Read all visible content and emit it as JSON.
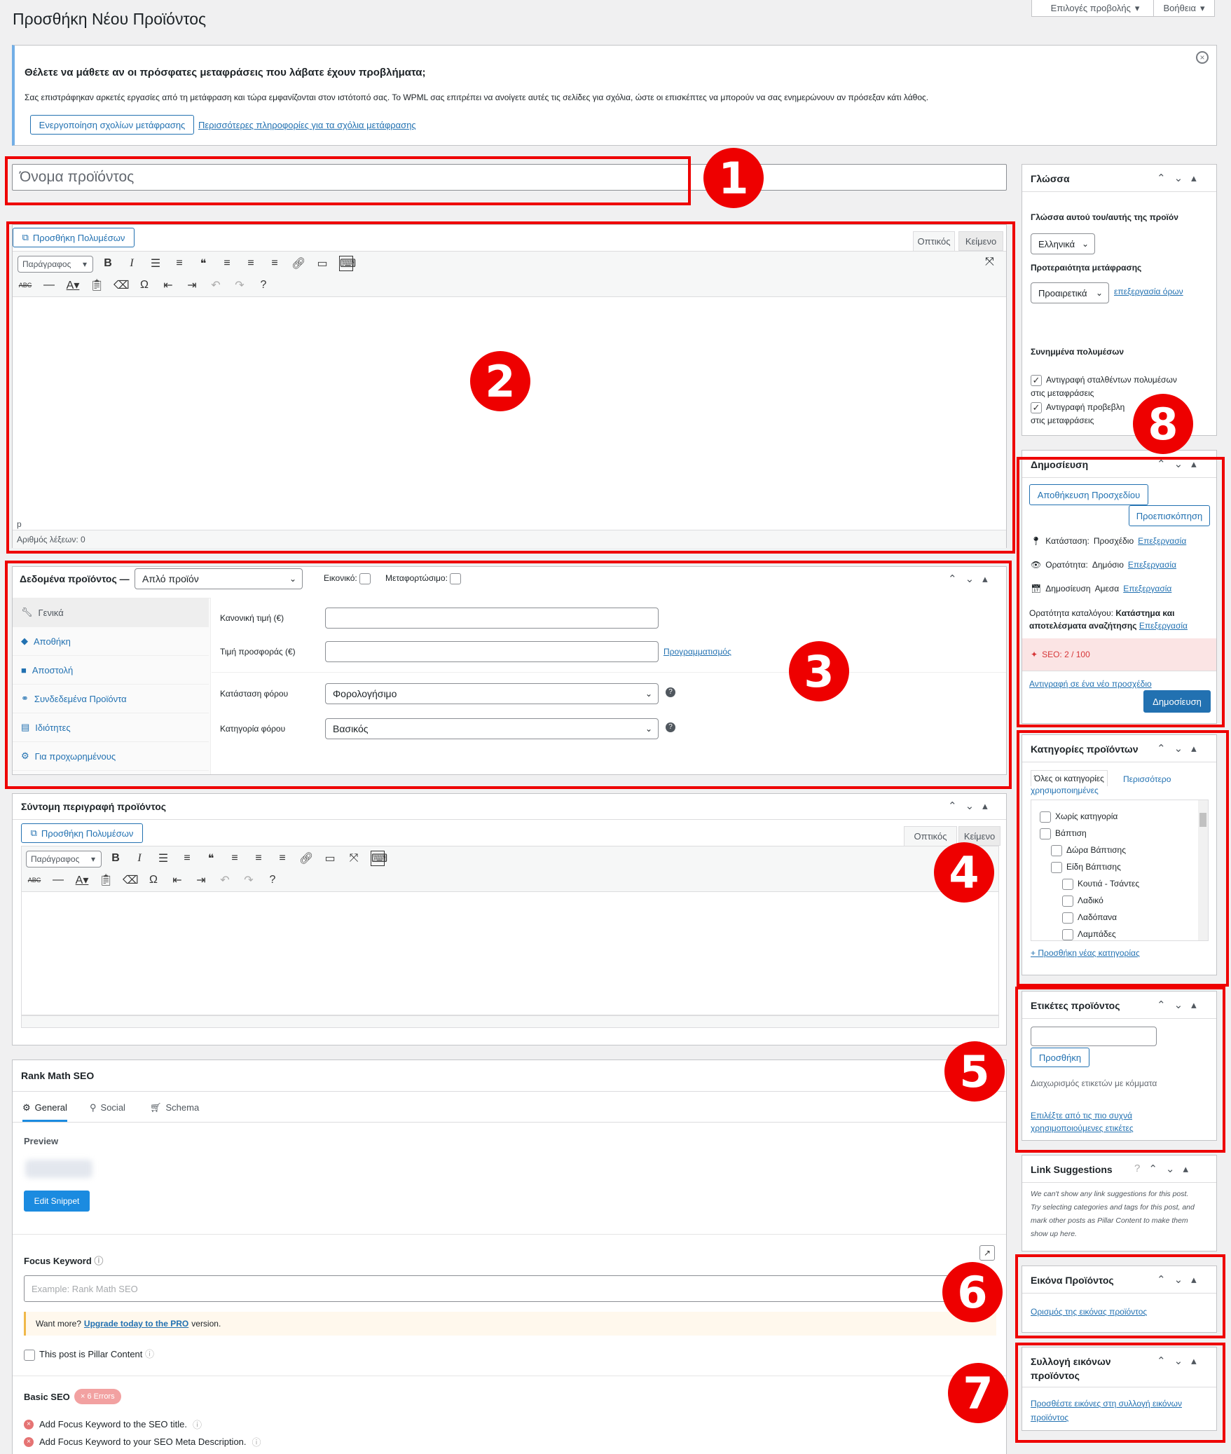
{
  "page": {
    "title": "Προσθήκη Νέου Προϊόντος"
  },
  "topbar": {
    "screen_options": "Επιλογές προβολής",
    "help": "Βοήθεια"
  },
  "notice": {
    "title": "Θέλετε να μάθετε αν οι πρόσφατες μεταφράσεις που λάβατε έχουν προβλήματα;",
    "body": "Σας επιστράφηκαν αρκετές εργασίες από τη μετάφραση και τώρα εμφανίζονται στον ιστότοπό σας. Το WPML σας επιτρέπει να ανοίγετε αυτές τις σελίδες για σχόλια, ώστε οι επισκέπτες να μπορούν να σας ενημερώνουν αν πρόσεξαν κάτι λάθος.",
    "enable_button": "Ενεργοποίηση σχολίων μετάφρασης",
    "more_link": "Περισσότερες πληροφορίες για τα σχόλια μετάφρασης"
  },
  "title_input": {
    "placeholder": "Όνομα προϊόντος"
  },
  "editor": {
    "add_media": "Προσθήκη Πολυμέσων",
    "tab_visual": "Οπτικός",
    "tab_text": "Κείμενο",
    "format": "Παράγραφος",
    "path": "p",
    "word_count": "Αριθμός λέξεων: 0"
  },
  "product_data": {
    "title": "Δεδομένα προϊόντος —",
    "type": "Απλό προϊόν",
    "virtual": "Εικονικό:",
    "downloadable": "Μεταφορτώσιμο:",
    "tabs": [
      "Γενικά",
      "Αποθήκη",
      "Αποστολή",
      "Συνδεδεμένα Προϊόντα",
      "Ιδιότητες",
      "Για προχωρημένους"
    ],
    "regular_price_label": "Κανονική τιμή (€)",
    "sale_price_label": "Τιμή προσφοράς (€)",
    "schedule_link": "Προγραμματισμός",
    "tax_status_label": "Κατάσταση φόρου",
    "tax_status_value": "Φορολογήσιμο",
    "tax_class_label": "Κατηγορία φόρου",
    "tax_class_value": "Βασικός"
  },
  "short_desc": {
    "title": "Σύντομη περιγραφή προϊόντος",
    "add_media": "Προσθήκη Πολυμέσων",
    "tab_visual": "Οπτικός",
    "tab_text": "Κείμενο",
    "format": "Παράγραφος"
  },
  "rankmath": {
    "title": "Rank Math SEO",
    "tabs": [
      "General",
      "Social",
      "Schema"
    ],
    "preview": "Preview",
    "edit_snippet": "Edit Snippet",
    "focus_keyword": "Focus Keyword",
    "focus_placeholder": "Example: Rank Math SEO",
    "want_more": "Want more?",
    "upgrade_link": "Upgrade today to the PRO",
    "version": "version.",
    "pillar": "This post is Pillar Content",
    "basic_seo": "Basic SEO",
    "errors_badge": "× 6 Errors",
    "checks": [
      "Add Focus Keyword to the SEO title.",
      "Add Focus Keyword to your SEO Meta Description."
    ]
  },
  "language_box": {
    "title": "Γλώσσα",
    "lang_label": "Γλώσσα αυτού του/αυτής της προϊόν",
    "lang_value": "Ελληνικά",
    "priority_label": "Προτεραιότητα μετάφρασης",
    "priority_value": "Προαιρετικά",
    "edit_terms": "επεξεργασία όρων",
    "media_label": "Συνημμένα πολυμέσων",
    "copy1a": "Αντιγραφή σταλθέντων πολυμέσων",
    "copy1b": "στις μεταφράσεις",
    "copy2a": "Αντιγραφή προβεβλη",
    "copy2b": "στις μεταφράσεις"
  },
  "publish": {
    "title": "Δημοσίευση",
    "save_draft": "Αποθήκευση Προσχεδίου",
    "preview": "Προεπισκόπηση",
    "status_label": "Κατάσταση:",
    "status_value": "Προσχέδιο",
    "visibility_label": "Ορατότητα:",
    "visibility_value": "Δημόσιο",
    "publish_label": "Δημοσίευση",
    "publish_value": "Αμεσα",
    "edit": "Επεξεργασία",
    "catalog_label": "Ορατότητα καταλόγου:",
    "catalog_value_a": "Κατάστημα και",
    "catalog_value_b": "αποτελέσματα αναζήτησης",
    "seo": "SEO: 2 / 100",
    "copy_draft": "Αντιγραφή σε ένα νέο προσχέδιο",
    "publish_button": "Δημοσίευση"
  },
  "categories": {
    "title": "Κατηγορίες προϊόντων",
    "tab_all": "Όλες οι κατηγορίες",
    "tab_popular_a": "Περισσότερο",
    "tab_popular_b": "χρησιμοποιημένες",
    "items": [
      "Χωρίς κατηγορία",
      "Βάπτιση",
      "Δώρα Βάπτισης",
      "Είδη Βάπτισης",
      "Κουτιά - Τσάντες",
      "Λαδικό",
      "Λαδόπανα",
      "Λαμπάδες"
    ],
    "add_new": "+ Προσθήκη νέας κατηγορίας"
  },
  "tags": {
    "title": "Ετικέτες προϊόντος",
    "add_button": "Προσθήκη",
    "hint": "Διαχωρισμός ετικετών με κόμματα",
    "choose_a": "Επιλέξτε από τις πιο συχνά",
    "choose_b": "χρησιμοποιούμενες ετικέτες"
  },
  "link_suggestions": {
    "title": "Link Suggestions",
    "lines": [
      "We can't show any link suggestions for this post.",
      "Try selecting categories and tags for this post, and",
      "mark other posts as Pillar Content to make them",
      "show up here."
    ]
  },
  "product_image": {
    "title": "Εικόνα Προϊόντος",
    "set_link": "Ορισμός της εικόνας προϊόντος"
  },
  "gallery": {
    "title_a": "Συλλογή εικόνων",
    "title_b": "προϊόντος",
    "link_a": "Προσθέστε εικόνες στη συλλογή εικόνων",
    "link_b": "προϊόντος"
  },
  "annotations": [
    "1",
    "2",
    "3",
    "4",
    "5",
    "6",
    "7",
    "8"
  ],
  "colors": {
    "annotation_red": "#ee0000",
    "wp_blue": "#2271b1",
    "rankmath_blue": "#1b8be0",
    "error_red": "#dd3333"
  }
}
